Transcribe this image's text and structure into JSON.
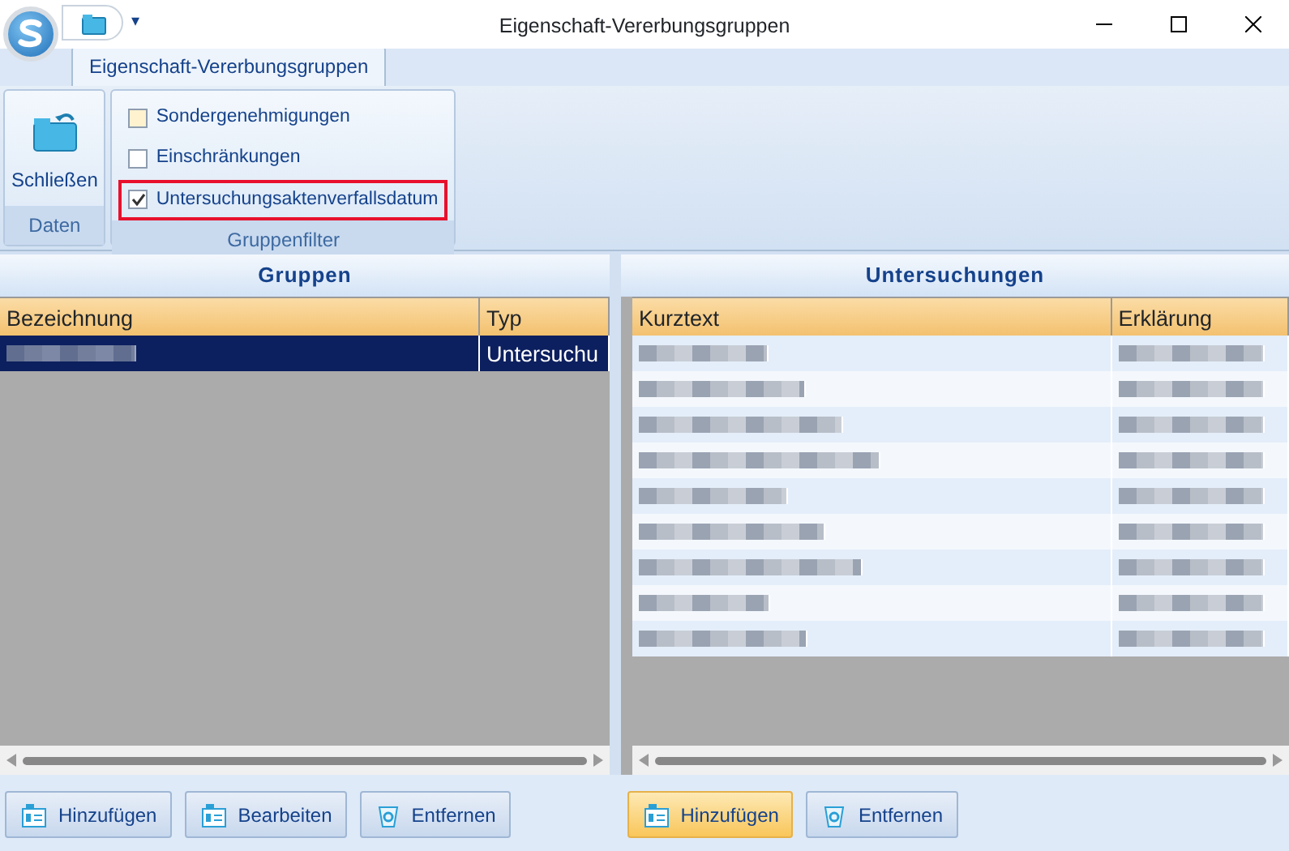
{
  "window": {
    "title": "Eigenschaft-Vererbungsgruppen",
    "quick_access": "▾"
  },
  "ribbon": {
    "tab": {
      "label": "Eigenschaft-Vererbungsgruppen",
      "selected": true
    },
    "groups": [
      {
        "label": "Daten",
        "kind": "buttons",
        "items": [
          {
            "label": "Schließen"
          }
        ]
      },
      {
        "label": "Gruppenfilter",
        "kind": "checks",
        "items": [
          {
            "label": "Sondergenehmigungen",
            "checked": false,
            "highlighted": false
          },
          {
            "label": "Einschränkungen",
            "checked": false,
            "highlighted": false
          },
          {
            "label": "Untersuchungsaktenverfallsdatum",
            "checked": true,
            "highlighted": true
          }
        ]
      }
    ]
  },
  "panels": [
    {
      "title": "Gruppen",
      "columns": [
        "Bezeichnung",
        "Typ"
      ],
      "rows": [
        {
          "selected": true,
          "cells": [
            "",
            "Untersuchu"
          ]
        }
      ],
      "buttons": [
        {
          "label": "Hinzufügen",
          "kind": "add",
          "active": false
        },
        {
          "label": "Bearbeiten",
          "kind": "edit",
          "active": false
        },
        {
          "label": "Entfernen",
          "kind": "remove",
          "active": false
        }
      ]
    },
    {
      "title": "Untersuchungen",
      "columns": [
        "Kurztext",
        "Erklärung"
      ],
      "rows": [
        {
          "selected": false,
          "cells": [
            "",
            ""
          ]
        },
        {
          "selected": false,
          "cells": [
            "",
            ""
          ]
        },
        {
          "selected": false,
          "cells": [
            "",
            ""
          ]
        },
        {
          "selected": false,
          "cells": [
            "",
            ""
          ]
        },
        {
          "selected": false,
          "cells": [
            "",
            ""
          ]
        },
        {
          "selected": false,
          "cells": [
            "",
            ""
          ]
        },
        {
          "selected": false,
          "cells": [
            "",
            ""
          ]
        },
        {
          "selected": false,
          "cells": [
            "",
            ""
          ]
        },
        {
          "selected": false,
          "cells": [
            "",
            ""
          ]
        }
      ],
      "buttons": [
        {
          "label": "Hinzufügen",
          "kind": "add",
          "active": true
        },
        {
          "label": "Entfernen",
          "kind": "remove",
          "active": false
        }
      ]
    }
  ]
}
